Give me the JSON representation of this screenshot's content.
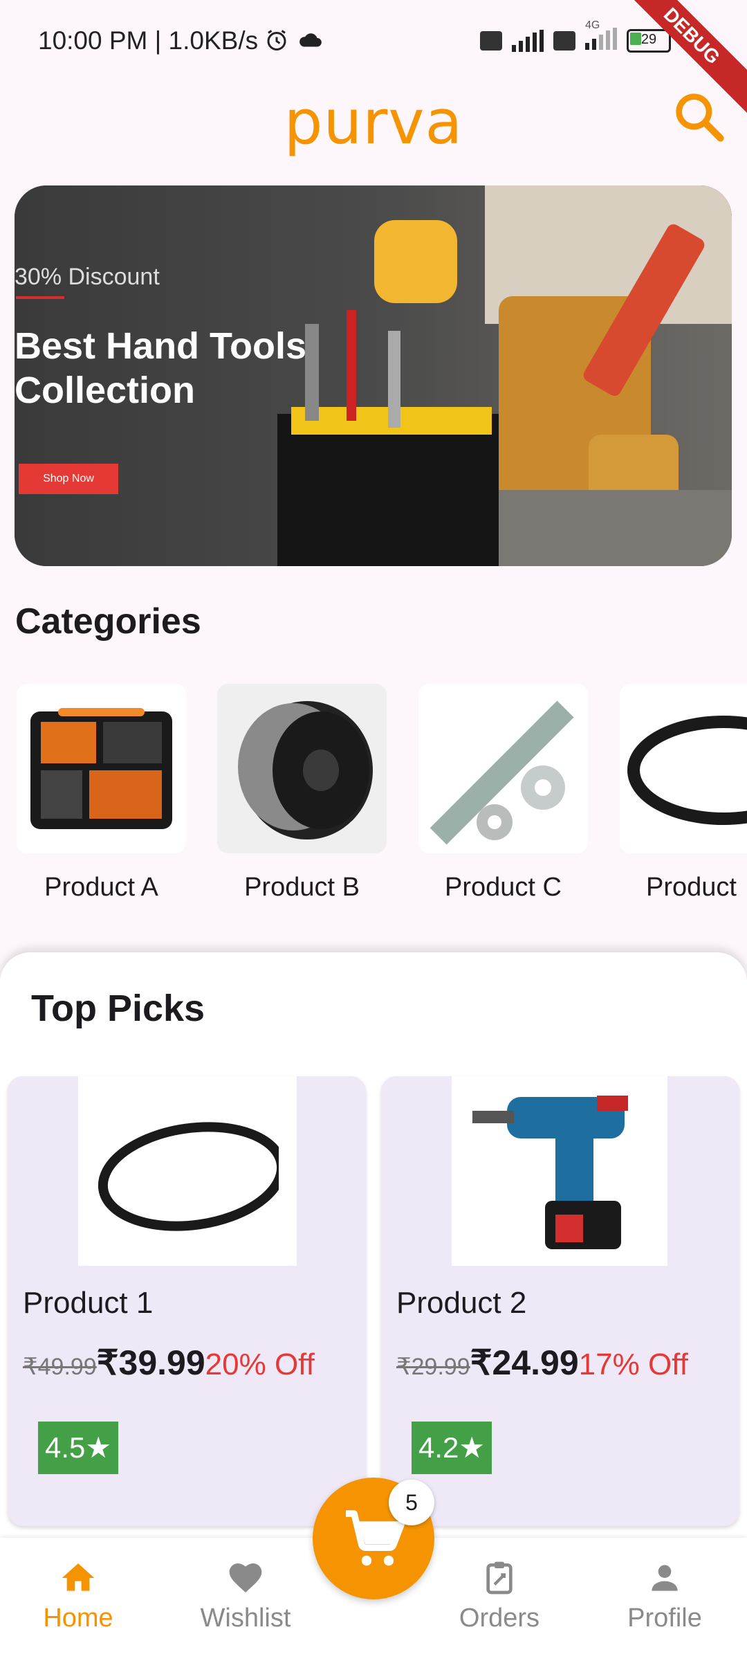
{
  "status_bar": {
    "time_net": "10:00 PM | 1.0KB/s",
    "network_label": "4G",
    "battery": "29",
    "debug_banner": "DEBUG"
  },
  "header": {
    "logo": "purva",
    "search_icon": "search-icon"
  },
  "banner": {
    "discount": "30% Discount",
    "headline": "Best Hand Tools\nCollection",
    "cta": "Shop Now"
  },
  "categories": {
    "title": "Categories",
    "items": [
      {
        "label": "Product A",
        "icon": "toolkit-image"
      },
      {
        "label": "Product B",
        "icon": "pulley-image"
      },
      {
        "label": "Product C",
        "icon": "rod-washer-image"
      },
      {
        "label": "Product",
        "icon": "belt-image"
      }
    ]
  },
  "top_picks": {
    "title": "Top Picks",
    "items": [
      {
        "name": "Product 1",
        "orig_price": "₹49.99",
        "price": "₹39.99",
        "discount": "20% Off",
        "rating": "4.5★"
      },
      {
        "name": "Product 2",
        "orig_price": "₹29.99",
        "price": "₹24.99",
        "discount": "17% Off",
        "rating": "4.2★"
      }
    ]
  },
  "cart": {
    "count": "5"
  },
  "nav": {
    "items": [
      {
        "label": "Home",
        "icon": "home-icon",
        "active": true
      },
      {
        "label": "Wishlist",
        "icon": "heart-icon",
        "active": false
      },
      {
        "label": "Orders",
        "icon": "orders-icon",
        "active": false
      },
      {
        "label": "Profile",
        "icon": "person-icon",
        "active": false
      }
    ]
  },
  "colors": {
    "accent": "#f59400",
    "discount": "#e53935",
    "rating": "#43a047",
    "inactive": "#8a8a8a"
  }
}
